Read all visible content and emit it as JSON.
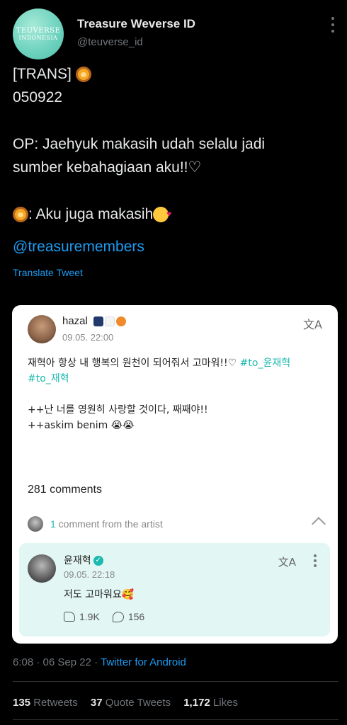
{
  "account": {
    "name": "Treasure Weverse ID",
    "handle": "@teuverse_id",
    "avatar_text_1": "TEUVERSE",
    "avatar_text_2": "INDONESIA"
  },
  "tweet": {
    "line1": "[TRANS]",
    "line2": "050922",
    "line3": "OP: Jaehyuk makasih udah selalu jadi",
    "line4": "sumber kebahagiaan aku!!♡",
    "line5": ": Aku juga makasih",
    "mention": "@treasuremembers",
    "translate_label": "Translate Tweet"
  },
  "card": {
    "username": "hazal",
    "date": "09.05. 22:00",
    "body_line1": "재혁아 항상 내 행복의 원천이 되어줘서 고마워!!♡ ",
    "hashtag1": "#to_윤재혁",
    "hashtag2": "#to_재혁",
    "body_line3": "++난 너를 영원히 사랑할 것이다, 째째야!!",
    "body_line4": "++askim benim 😭😭",
    "comments_count": "281 comments",
    "artist_count": "1",
    "artist_row_label": " comment from the artist",
    "artist": {
      "name": "윤재혁",
      "date": "09.05. 22:18",
      "comment": "저도 고마워요🥰",
      "likes": "1.9K",
      "replies": "156"
    }
  },
  "meta": {
    "time": "6:08 · 06 Sep 22 · ",
    "source": "Twitter for Android"
  },
  "stats": {
    "retweets_count": "135",
    "retweets_label": " Retweets",
    "quotes_count": "37",
    "quotes_label": " Quote Tweets",
    "likes_count": "1,172",
    "likes_label": " Likes"
  },
  "colors": {
    "link": "#1d9bf0",
    "hashtag": "#1bb9b0",
    "artist_box": "#e2f6f3"
  }
}
